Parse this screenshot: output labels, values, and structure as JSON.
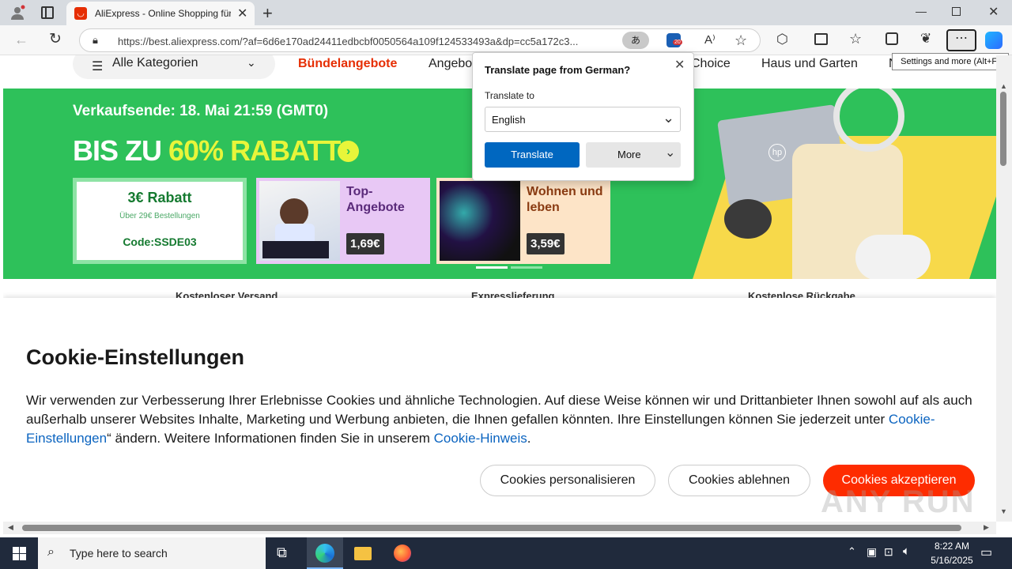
{
  "browser": {
    "tab_title": "AliExpress - Online Shopping für",
    "url": "https://best.aliexpress.com/?af=6d6e170ad24411edbcbf0050564a109f124533493a&dp=cc5a172c3...",
    "shield_badge": "20",
    "tooltip": "Settings and more (Alt+F)"
  },
  "nav": {
    "categories_label": "Alle Kategorien",
    "items": [
      "Bündelangebote",
      "Angebo",
      "Choice",
      "Haus und Garten",
      "N"
    ]
  },
  "banner": {
    "sale_end": "Verkaufsende: 18. Mai 21:59 (GMT0)",
    "headline_prefix": "BIS ZU ",
    "headline_percent": "60%",
    "headline_suffix": " RABATT",
    "coupon_title": "3€ Rabatt",
    "coupon_sub": "Über 29€ Bestellungen",
    "coupon_code": "Code:SSDE03",
    "card1_title": "Top-Angebote",
    "card1_price": "1,69€",
    "card2_title": "Wohnen und leben",
    "card2_price": "3,59€",
    "hp_logo": "hp"
  },
  "features": [
    "Kostenloser Versand",
    "Expresslieferung",
    "Kostenlose Rückgabe"
  ],
  "cookie": {
    "title": "Cookie-Einstellungen",
    "body_1": "Wir verwenden zur Verbesserung Ihrer Erlebnisse Cookies und ähnliche Technologien. Auf diese Weise können wir und Drittanbieter Ihnen sowohl auf als auch außerhalb unserer Websites Inhalte, Marketing und Werbung anbieten, die Ihnen gefallen könnten. Ihre Einstellungen können Sie jederzeit unter ",
    "link_1": "Cookie-Einstellungen",
    "body_2": "“ ändern. Weitere Informationen finden Sie in unserem ",
    "link_2": "Cookie-Hinweis",
    "body_3": ".",
    "btn_personalize": "Cookies personalisieren",
    "btn_reject": "Cookies ablehnen",
    "btn_accept": "Cookies akzeptieren"
  },
  "translate": {
    "title": "Translate page from German?",
    "to_label": "Translate to",
    "language": "English",
    "translate_btn": "Translate",
    "more_btn": "More"
  },
  "taskbar": {
    "search_placeholder": "Type here to search",
    "time": "8:22 AM",
    "date": "5/16/2025"
  },
  "watermark": "ANY RUN",
  "colors": {
    "ali_red": "#e62e04",
    "banner_green": "#2ec15a",
    "accent_yellow": "#e8f53a",
    "edge_blue": "#0067c0",
    "link_blue": "#0b64c0"
  }
}
